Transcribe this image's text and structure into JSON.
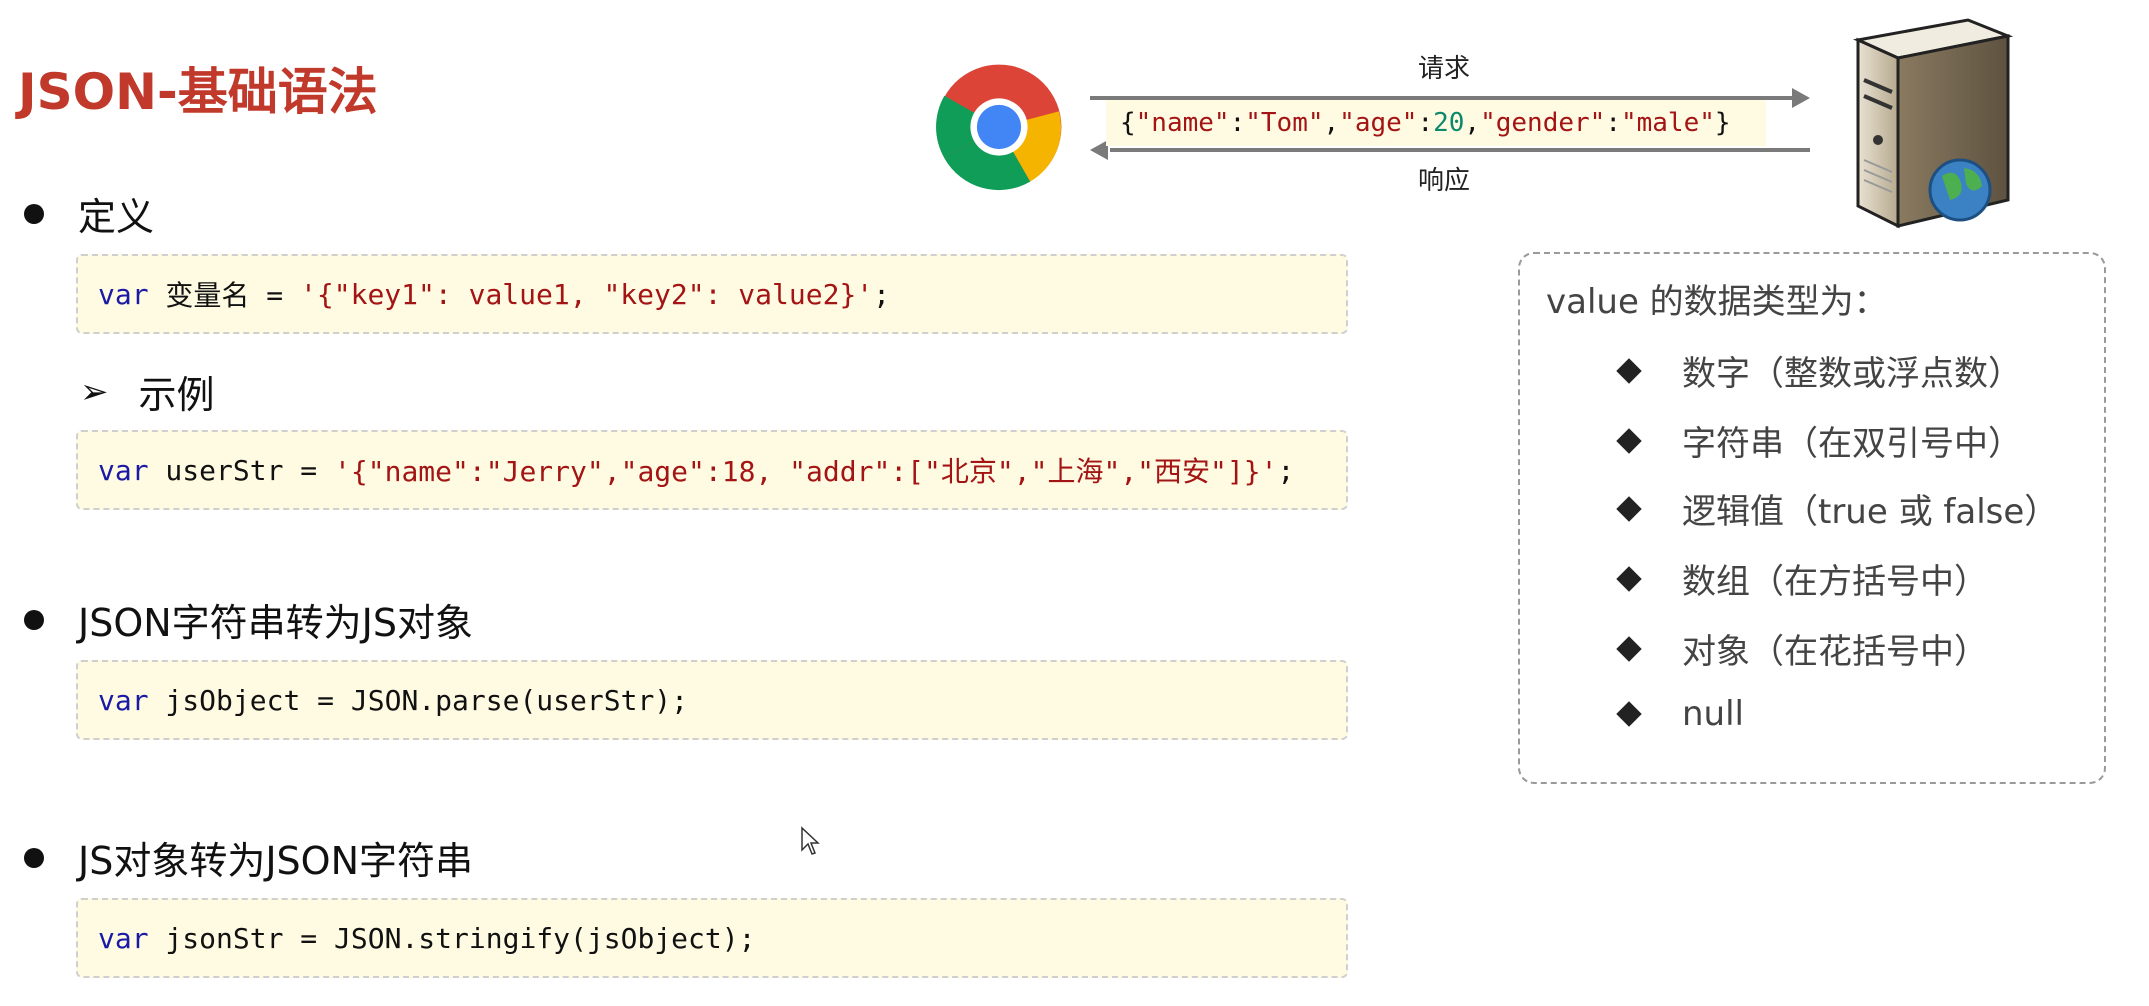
{
  "title": "JSON-基础语法",
  "diagram": {
    "request_label": "请求",
    "response_label": "响应",
    "json_parts": [
      "{",
      "\"name\"",
      ":",
      "\"Tom\"",
      ",",
      "\"age\"",
      ":",
      "20",
      ",",
      "\"gender\"",
      ":",
      "\"male\"",
      "}"
    ]
  },
  "sections": {
    "definition": {
      "bullet": "定义",
      "code": {
        "kw": "var",
        "plain": " 变量名 = ",
        "str": "'{\"key1\": value1, \"key2\": value2}'",
        "end": ";"
      }
    },
    "example": {
      "label": "示例",
      "code": {
        "kw": "var",
        "plain": " userStr = ",
        "str": "'{\"name\":\"Jerry\",\"age\":18, \"addr\":[\"北京\",\"上海\",\"西安\"]}'",
        "end": ";"
      }
    },
    "parse": {
      "bullet": "JSON字符串转为JS对象",
      "code": {
        "kw": "var",
        "plain": " jsObject = JSON.parse(userStr);"
      }
    },
    "stringify": {
      "bullet": "JS对象转为JSON字符串",
      "code": {
        "kw": "var",
        "plain": " jsonStr = JSON.stringify(jsObject);"
      }
    }
  },
  "value_types": {
    "title": "value 的数据类型为：",
    "items": [
      "数字（整数或浮点数）",
      "字符串（在双引号中）",
      "逻辑值（true 或 false）",
      "数组（在方括号中）",
      "对象（在花括号中）",
      "null"
    ]
  },
  "icons": {
    "browser": "chrome-icon",
    "server": "server-icon",
    "cursor": "mouse-cursor-icon"
  }
}
